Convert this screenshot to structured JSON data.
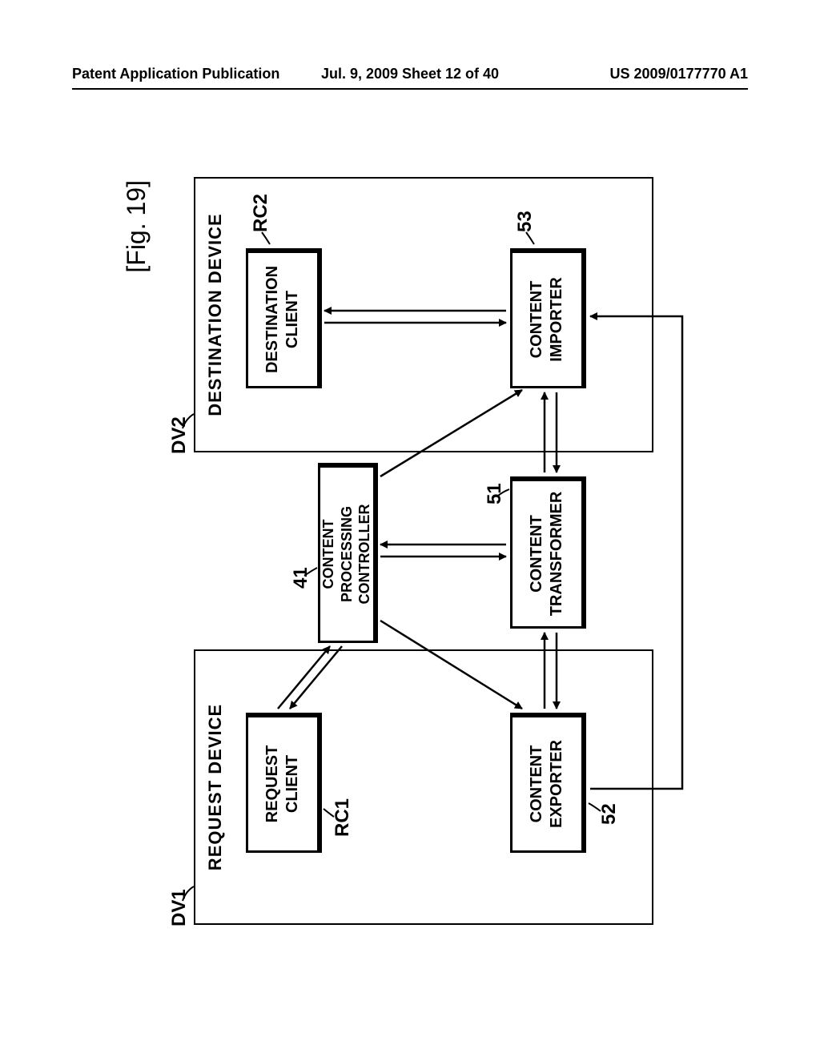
{
  "header": {
    "left": "Patent Application Publication",
    "center": "Jul. 9, 2009  Sheet 12 of 40",
    "right": "US 2009/0177770 A1"
  },
  "figure_label": "[Fig. 19]",
  "devices": {
    "dv1": {
      "tag": "DV1",
      "title": "REQUEST DEVICE"
    },
    "dv2": {
      "tag": "DV2",
      "title": "DESTINATION DEVICE"
    }
  },
  "blocks": {
    "rc1": {
      "label": "REQUEST\nCLIENT",
      "tag": "RC1"
    },
    "ce": {
      "label": "CONTENT\nEXPORTER",
      "tag": "52"
    },
    "rc2": {
      "label": "DESTINATION\nCLIENT",
      "tag": "RC2"
    },
    "ci": {
      "label": "CONTENT\nIMPORTER",
      "tag": "53"
    },
    "cpc": {
      "label": "CONTENT PROCESSING\nCONTROLLER",
      "tag": "41"
    },
    "ct": {
      "label": "CONTENT\nTRANSFORMER",
      "tag": "51"
    }
  },
  "chart_data": {
    "type": "diagram",
    "title": "Fig. 19",
    "nodes": [
      {
        "id": "DV1",
        "label": "REQUEST DEVICE",
        "type": "container"
      },
      {
        "id": "DV2",
        "label": "DESTINATION DEVICE",
        "type": "container"
      },
      {
        "id": "RC1",
        "label": "REQUEST CLIENT",
        "parent": "DV1"
      },
      {
        "id": "52",
        "label": "CONTENT EXPORTER",
        "parent": "DV1"
      },
      {
        "id": "RC2",
        "label": "DESTINATION CLIENT",
        "parent": "DV2"
      },
      {
        "id": "53",
        "label": "CONTENT IMPORTER",
        "parent": "DV2"
      },
      {
        "id": "41",
        "label": "CONTENT PROCESSING CONTROLLER"
      },
      {
        "id": "51",
        "label": "CONTENT TRANSFORMER"
      }
    ],
    "edges": [
      {
        "from": "RC1",
        "to": "41",
        "bidirectional": true
      },
      {
        "from": "41",
        "to": "52",
        "bidirectional": false
      },
      {
        "from": "41",
        "to": "53",
        "bidirectional": false
      },
      {
        "from": "41",
        "to": "51",
        "bidirectional": true
      },
      {
        "from": "RC2",
        "to": "53",
        "bidirectional": true
      },
      {
        "from": "52",
        "to": "51",
        "bidirectional": true
      },
      {
        "from": "51",
        "to": "53",
        "bidirectional": true
      },
      {
        "from": "52",
        "to": "53",
        "bidirectional": true,
        "note": "bottom feedthrough"
      }
    ]
  }
}
